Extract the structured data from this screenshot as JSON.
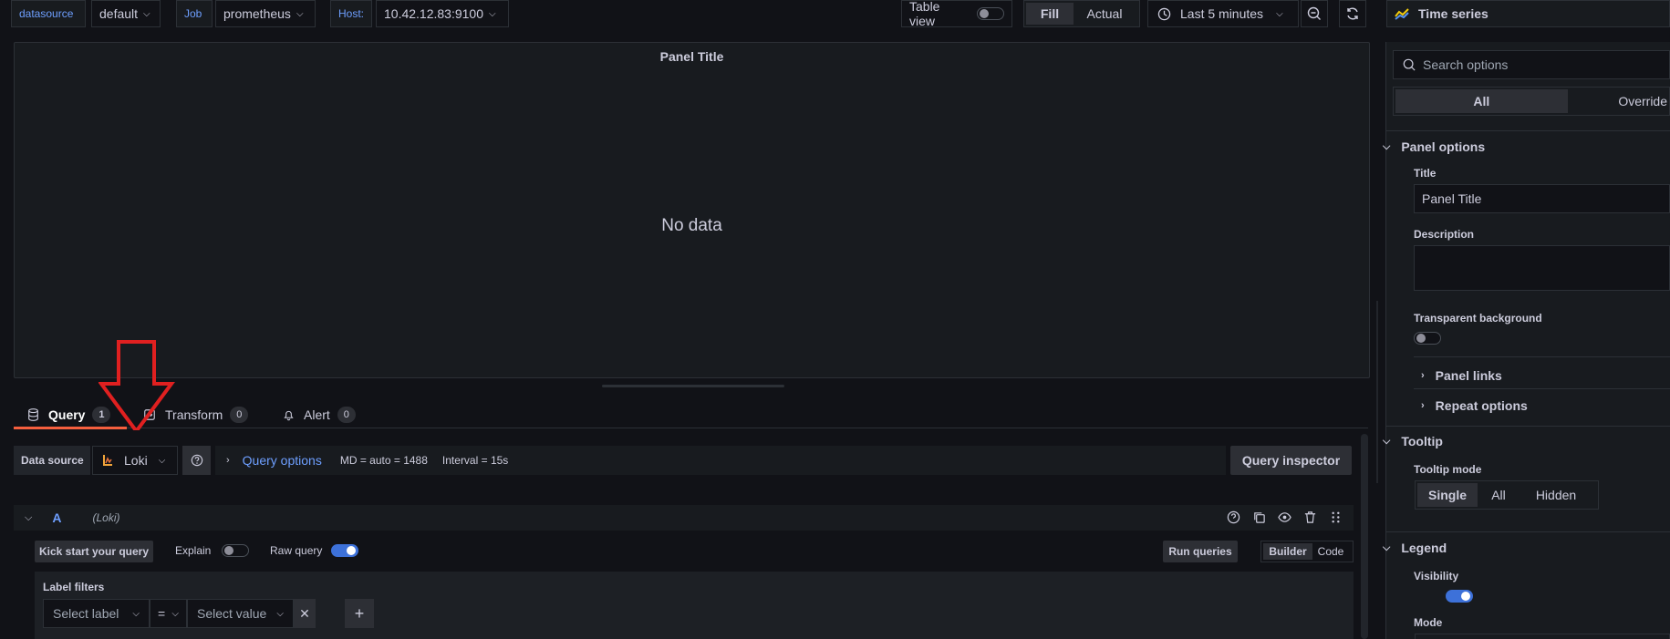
{
  "variables": [
    {
      "label": "datasource",
      "value": "default"
    },
    {
      "label": "Job",
      "value": "prometheus"
    },
    {
      "label": "Host:",
      "value": "10.42.12.83:9100"
    }
  ],
  "toolbar": {
    "table_view_label": "Table view",
    "fill_label": "Fill",
    "actual_label": "Actual",
    "time_range": "Last 5 minutes",
    "visualization": "Time series"
  },
  "panel": {
    "title": "Panel Title",
    "no_data": "No data"
  },
  "tabs": [
    {
      "label": "Query",
      "count": "1"
    },
    {
      "label": "Transform",
      "count": "0"
    },
    {
      "label": "Alert",
      "count": "0"
    }
  ],
  "query_row": {
    "datasource_label": "Data source",
    "datasource_value": "Loki",
    "query_options_label": "Query options",
    "md": "MD = auto = 1488",
    "interval": "Interval = 15s",
    "inspector_label": "Query inspector"
  },
  "query_a": {
    "ref": "A",
    "datasource": "(Loki)",
    "kick_start": "Kick start your query",
    "explain": "Explain",
    "raw_query": "Raw query",
    "run_queries": "Run queries",
    "builder": "Builder",
    "code": "Code",
    "label_filters": "Label filters",
    "select_label": "Select label",
    "operator": "=",
    "select_value": "Select value"
  },
  "options": {
    "search_placeholder": "Search options",
    "tab_all": "All",
    "tab_overrides": "Override",
    "panel_options": "Panel options",
    "title_label": "Title",
    "title_value": "Panel Title",
    "description_label": "Description",
    "transparent_label": "Transparent background",
    "panel_links": "Panel links",
    "repeat_options": "Repeat options",
    "tooltip": "Tooltip",
    "tooltip_mode_label": "Tooltip mode",
    "tooltip_modes": [
      "Single",
      "All",
      "Hidden"
    ],
    "legend": "Legend",
    "visibility_label": "Visibility",
    "mode_label": "Mode"
  },
  "colors": {
    "accent": "#3d71d9",
    "link": "#6e9fff",
    "tab_underline": "#f55f3e",
    "annotation_arrow": "#e02020"
  }
}
